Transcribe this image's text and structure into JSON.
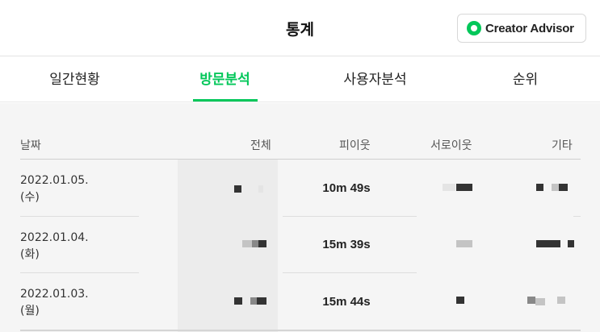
{
  "header": {
    "title": "통계",
    "creator_advisor_label": "Creator Advisor"
  },
  "tabs": [
    {
      "label": "일간현황",
      "active": false
    },
    {
      "label": "방문분석",
      "active": true
    },
    {
      "label": "사용자분석",
      "active": false
    },
    {
      "label": "순위",
      "active": false
    }
  ],
  "table": {
    "headers": {
      "date": "날짜",
      "total": "전체",
      "neighbor": "피이웃",
      "mutual": "서로이웃",
      "other": "기타"
    },
    "rows": [
      {
        "date": "2022.01.05.",
        "weekday": "(수)",
        "time": "10m 49s"
      },
      {
        "date": "2022.01.04.",
        "weekday": "(화)",
        "time": "15m 39s"
      },
      {
        "date": "2022.01.03.",
        "weekday": "(월)",
        "time": "15m 44s"
      }
    ]
  },
  "colors": {
    "accent": "#03c75a",
    "background": "#f5f5f5"
  },
  "icons": {
    "creator_advisor_logo": "creator-advisor-logo-icon"
  }
}
